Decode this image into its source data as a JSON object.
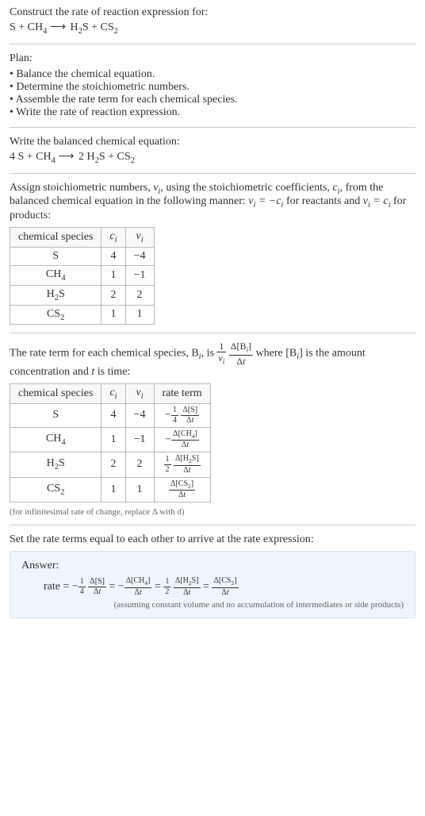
{
  "intro": {
    "prompt": "Construct the rate of reaction expression for:"
  },
  "plan": {
    "heading": "Plan:",
    "items": [
      "Balance the chemical equation.",
      "Determine the stoichiometric numbers.",
      "Assemble the rate term for each chemical species.",
      "Write the rate of reaction expression."
    ]
  },
  "balanced_heading": "Write the balanced chemical equation:",
  "stoich_text_prefix": "Assign stoichiometric numbers, ",
  "stoich_text_mid1": ", using the stoichiometric coefficients, ",
  "stoich_text_mid2": ", from the balanced chemical equation in the following manner: ",
  "stoich_text_mid3": " for reactants and ",
  "stoich_text_suffix": " for products:",
  "table1": {
    "headers": {
      "species": "chemical species",
      "ci": "cᵢ",
      "vi": "νᵢ"
    },
    "rows": [
      {
        "species": "S",
        "ci": "4",
        "vi": "−4"
      },
      {
        "species": "CH4",
        "ci": "1",
        "vi": "−1"
      },
      {
        "species": "H2S",
        "ci": "2",
        "vi": "2"
      },
      {
        "species": "CS2",
        "ci": "1",
        "vi": "1"
      }
    ]
  },
  "rateterm_text_prefix": "The rate term for each chemical species, B",
  "rateterm_text_mid1": ", is ",
  "rateterm_text_mid2": " where [B",
  "rateterm_text_mid3": "] is the amount concentration and ",
  "rateterm_text_suffix": " is time:",
  "table2": {
    "headers": {
      "species": "chemical species",
      "ci": "cᵢ",
      "vi": "νᵢ",
      "rate": "rate term"
    },
    "rows": [
      {
        "ci": "4",
        "vi": "−4"
      },
      {
        "ci": "1",
        "vi": "−1"
      },
      {
        "ci": "2",
        "vi": "2"
      },
      {
        "ci": "1",
        "vi": "1"
      }
    ]
  },
  "infinitesimal_note": "(for infinitesimal rate of change, replace Δ with d)",
  "final_heading": "Set the rate terms equal to each other to arrive at the rate expression:",
  "answer_label": "Answer:",
  "rate_eq_label": "rate = ",
  "assumption_note": "(assuming constant volume and no accumulation of intermediates or side products)",
  "chart_data": {
    "type": "table",
    "reaction_unbalanced": "S + CH4 → H2S + CS2",
    "reaction_balanced": "4 S + CH4 → 2 H2S + CS2",
    "stoichiometry": [
      {
        "species": "S",
        "c_i": 4,
        "nu_i": -4
      },
      {
        "species": "CH4",
        "c_i": 1,
        "nu_i": -1
      },
      {
        "species": "H2S",
        "c_i": 2,
        "nu_i": 2
      },
      {
        "species": "CS2",
        "c_i": 1,
        "nu_i": 1
      }
    ],
    "rate_terms": [
      {
        "species": "S",
        "term": "-(1/4) Δ[S]/Δt"
      },
      {
        "species": "CH4",
        "term": "-Δ[CH4]/Δt"
      },
      {
        "species": "H2S",
        "term": "(1/2) Δ[H2S]/Δt"
      },
      {
        "species": "CS2",
        "term": "Δ[CS2]/Δt"
      }
    ],
    "rate_expression": "rate = -(1/4) Δ[S]/Δt = -Δ[CH4]/Δt = (1/2) Δ[H2S]/Δt = Δ[CS2]/Δt"
  }
}
